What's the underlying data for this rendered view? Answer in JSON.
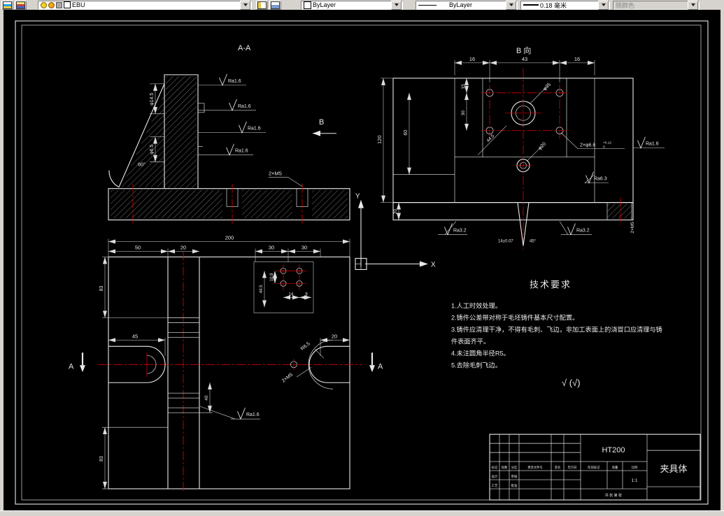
{
  "toolbar": {
    "layer_value": "EBU",
    "color_value": "ByLayer",
    "linetype_value": "ByLayer",
    "lineweight_value": "0.18 毫米",
    "plotstyle_value": "随颜色"
  },
  "labels": {
    "section_aa": "A-A",
    "view_b": "B 向",
    "arrow_b": "B",
    "marker_a_left": "A",
    "marker_a_right": "A",
    "axis_x": "X",
    "axis_y": "Y",
    "check_note": "√ (√)"
  },
  "tech": {
    "title": "技术要求",
    "lines": [
      "1.人工时效处理。",
      "2.铸件公差带对称于毛坯铸件基本尺寸配置。",
      "3.铸件应清理干净，不得有毛刺、飞边，非加工表面上的浇冒口应清理与铸",
      "件表面齐平。",
      "4.未注圆角半径R5。",
      "5.去除毛刺飞边。"
    ]
  },
  "dims": {
    "d200": "200",
    "d50": "50",
    "d20": "20",
    "d30": "30",
    "d83": "83",
    "d45": "45",
    "d40": "40",
    "d16": "16",
    "d43": "43",
    "d120": "120",
    "d60": "60",
    "d15": "15",
    "d14": "14",
    "d9": "9",
    "d10_8": "10.8",
    "d44_5": "44.5",
    "phi14_5": "φ14.5",
    "phi6_5": "φ6.5",
    "phi35": "φ35",
    "phi20": "φ20",
    "phi6_6": "2×φ6.6",
    "tol_up": "+0.12",
    "tol_dn": "0",
    "deg60": "60°",
    "deg45": "45°",
    "m5x2": "2×M5",
    "r6_5": "R6.5",
    "w14": "14±0.07",
    "ra16": "Ra1.6",
    "ra32": "Ra3.2",
    "ra63": "Ra6.3"
  },
  "titleblock": {
    "material": "HT200",
    "part_name": "夹具体",
    "hdr_mark": "标记",
    "hdr_count": "处数",
    "hdr_zone": "分区",
    "hdr_doc": "更改文件号",
    "hdr_sign": "签名",
    "hdr_date": "年月日",
    "design": "设计",
    "audit": "审核",
    "craft": "工艺",
    "approve": "批准",
    "stage": "阶段标记",
    "mass": "质量",
    "scale": "比例",
    "scale_value": "1:1",
    "sheet": "共 张 第 张"
  }
}
